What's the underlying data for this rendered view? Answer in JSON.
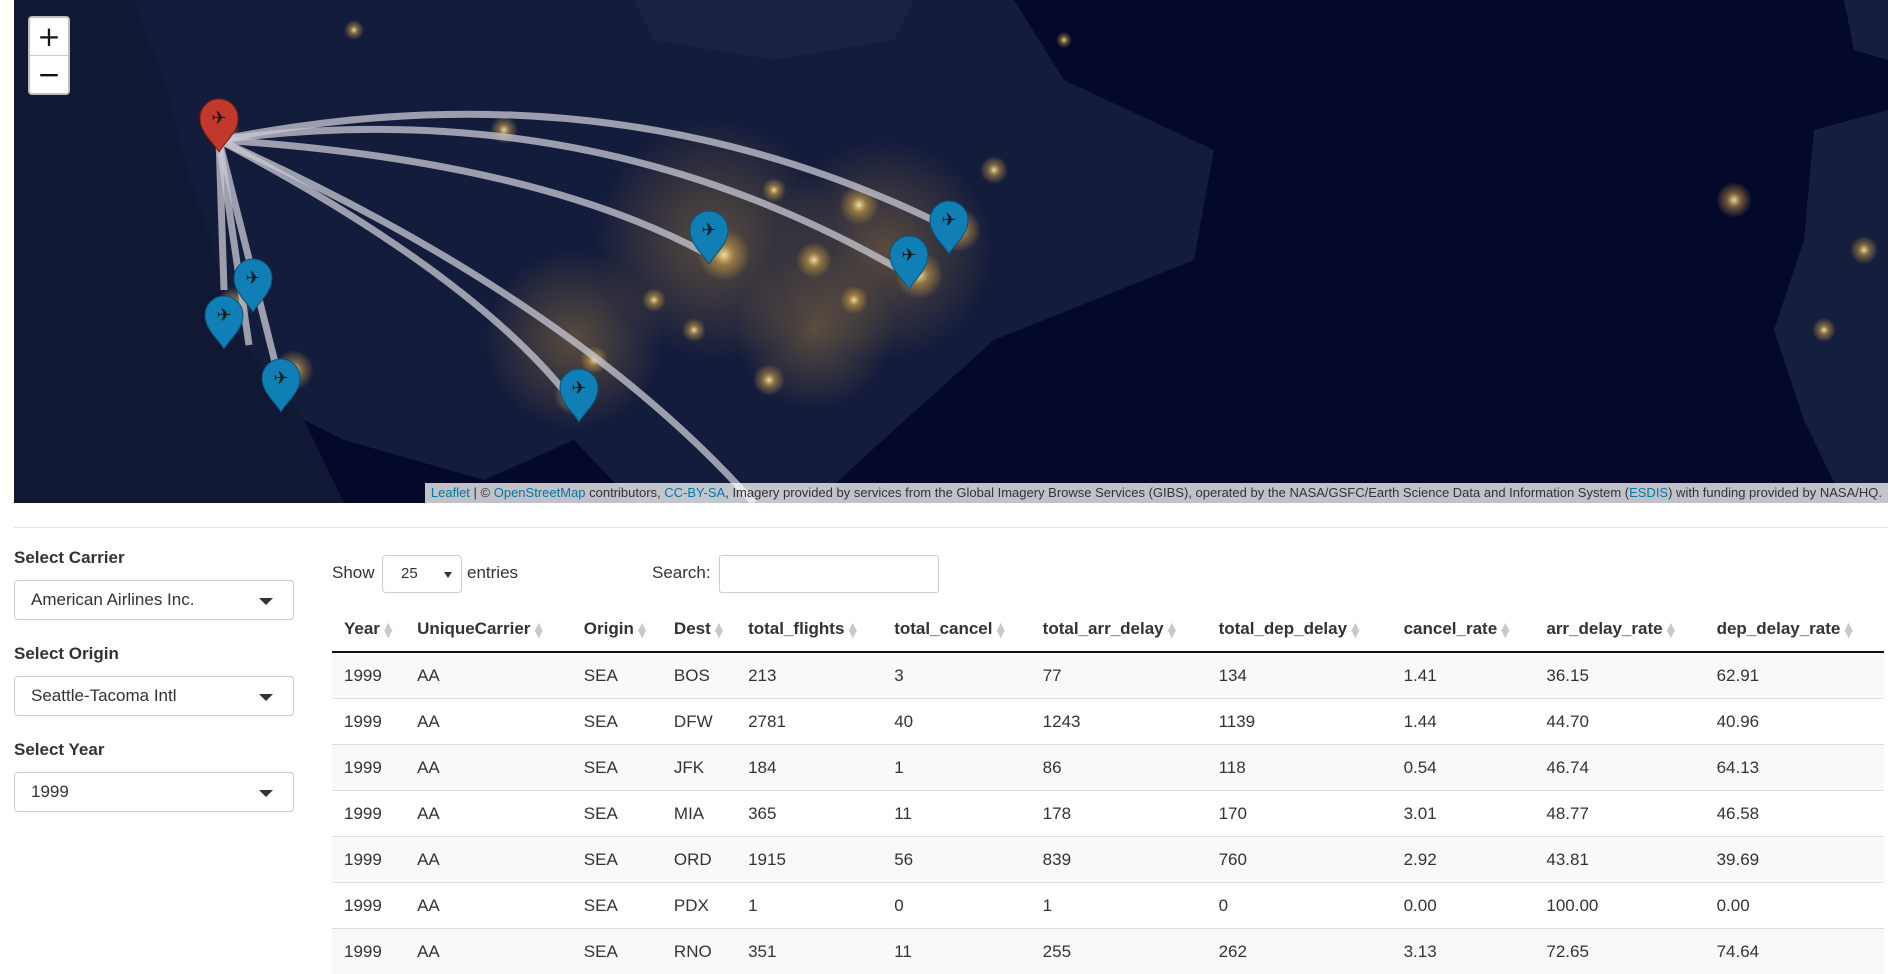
{
  "map": {
    "zoom_in": "+",
    "zoom_out": "−",
    "attribution": {
      "leaflet": "Leaflet",
      "sep1": " | © ",
      "osm": "OpenStreetMap",
      "contrib": " contributors, ",
      "ccbysa": "CC-BY-SA",
      "gibs": ", Imagery provided by services from the Global Imagery Browse Services (GIBS), operated by the NASA/GSFC/Earth Science Data and Information System (",
      "esdis": "ESDIS",
      "tail": ") with funding provided by NASA/HQ."
    },
    "origin_color": "#c0392b",
    "dest_color": "#0f7fb5"
  },
  "sidebar": {
    "carrier": {
      "label": "Select Carrier",
      "value": "American Airlines Inc."
    },
    "origin": {
      "label": "Select Origin",
      "value": "Seattle-Tacoma Intl"
    },
    "year": {
      "label": "Select Year",
      "value": "1999"
    }
  },
  "table_controls": {
    "show": "Show",
    "length": "25",
    "entries": "entries",
    "search": "Search:"
  },
  "table": {
    "columns": [
      "Year",
      "UniqueCarrier",
      "Origin",
      "Dest",
      "total_flights",
      "total_cancel",
      "total_arr_delay",
      "total_dep_delay",
      "cancel_rate",
      "arr_delay_rate",
      "dep_delay_rate"
    ],
    "rows": [
      [
        "1999",
        "AA",
        "SEA",
        "BOS",
        "213",
        "3",
        "77",
        "134",
        "1.41",
        "36.15",
        "62.91"
      ],
      [
        "1999",
        "AA",
        "SEA",
        "DFW",
        "2781",
        "40",
        "1243",
        "1139",
        "1.44",
        "44.70",
        "40.96"
      ],
      [
        "1999",
        "AA",
        "SEA",
        "JFK",
        "184",
        "1",
        "86",
        "118",
        "0.54",
        "46.74",
        "64.13"
      ],
      [
        "1999",
        "AA",
        "SEA",
        "MIA",
        "365",
        "11",
        "178",
        "170",
        "3.01",
        "48.77",
        "46.58"
      ],
      [
        "1999",
        "AA",
        "SEA",
        "ORD",
        "1915",
        "56",
        "839",
        "760",
        "2.92",
        "43.81",
        "39.69"
      ],
      [
        "1999",
        "AA",
        "SEA",
        "PDX",
        "1",
        "0",
        "1",
        "0",
        "0.00",
        "100.00",
        "0.00"
      ],
      [
        "1999",
        "AA",
        "SEA",
        "RNO",
        "351",
        "11",
        "255",
        "262",
        "3.13",
        "72.65",
        "74.64"
      ]
    ]
  }
}
